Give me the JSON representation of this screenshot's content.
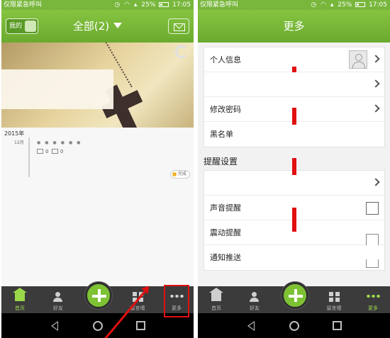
{
  "left": {
    "status": {
      "carrier": "仅限紧急呼叫",
      "battery": "25%",
      "time": "17:05"
    },
    "header": {
      "mine_label": "我的",
      "title": "全部(2)"
    },
    "timeline": {
      "year": "2015年",
      "month": "12月",
      "photo_count": "0",
      "comment_count": "0",
      "finish_badge": "完成"
    }
  },
  "right": {
    "status": {
      "carrier": "仅限紧急呼叫",
      "battery": "25%",
      "time": "17:05"
    },
    "header": {
      "title": "更多"
    },
    "group1": [
      "个人信息",
      "",
      "修改密码",
      "黑名单"
    ],
    "section_title": "提醒设置",
    "group2": [
      "",
      "声音提醒",
      "震动提醒",
      "通知推送"
    ]
  },
  "bottom_nav": {
    "home": "首页",
    "friends": "好友",
    "wall": "留言墙",
    "more": "更多"
  },
  "colors": {
    "brand_green": "#78b73c",
    "annotation_red": "#e01010"
  }
}
